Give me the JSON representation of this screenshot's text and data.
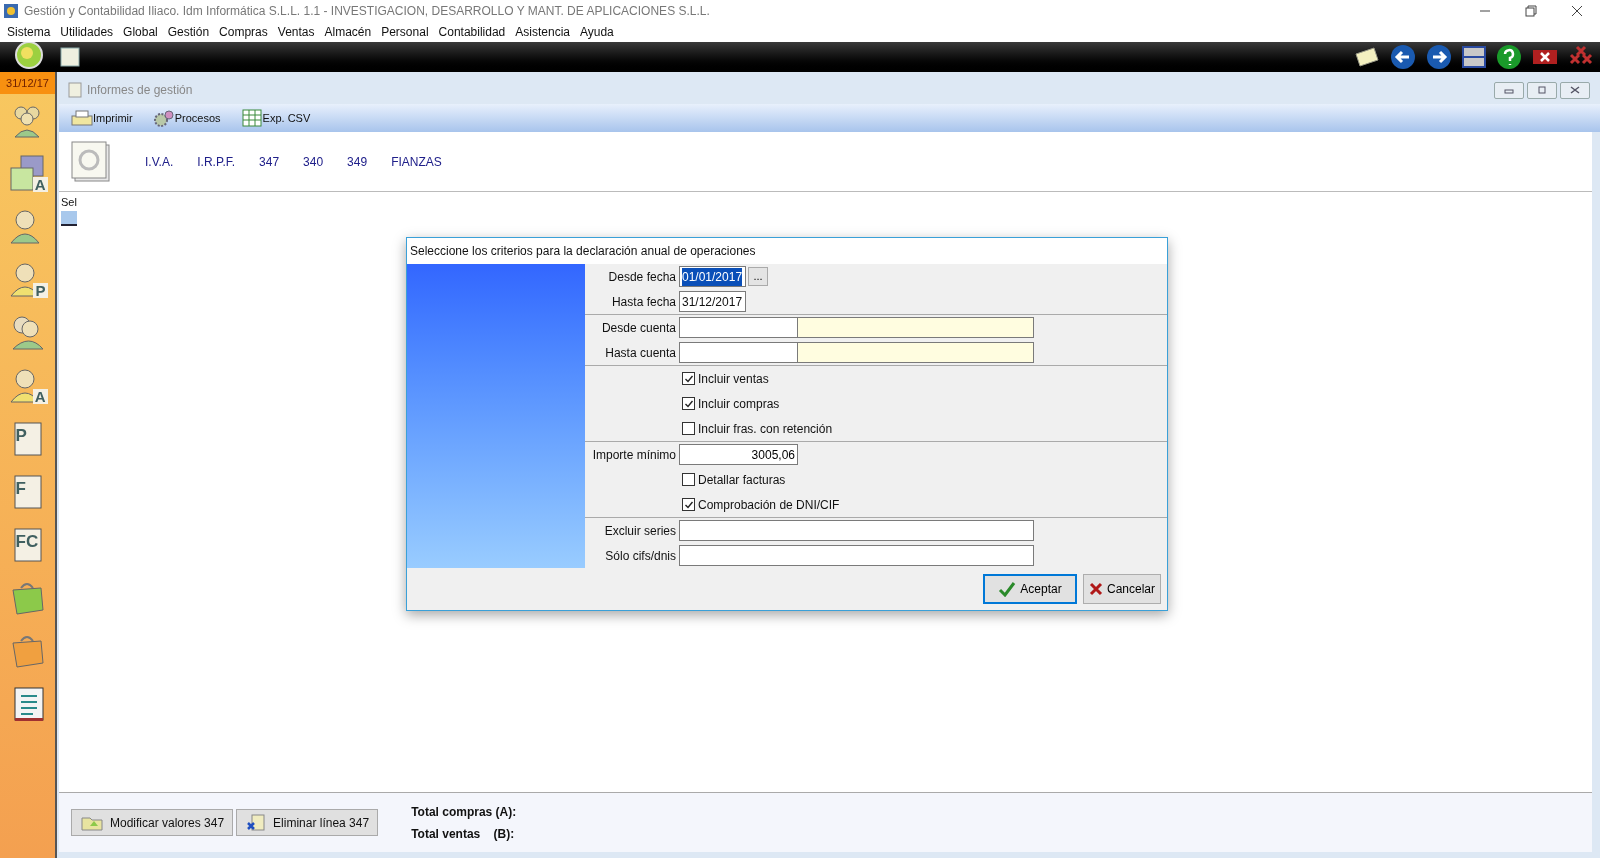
{
  "app_title": "Gestión y Contabilidad Iliaco. Idm Informática S.L.L. 1.1 - INVESTIGACION, DESARROLLO Y MANT. DE APLICACIONES S.L.L.",
  "menu": [
    "Sistema",
    "Utilidades",
    "Global",
    "Gestión",
    "Compras",
    "Ventas",
    "Almacén",
    "Personal",
    "Contabilidad",
    "Asistencia",
    "Ayuda"
  ],
  "date": "31/12/17",
  "sidebar": [
    {
      "kind": "group"
    },
    {
      "kind": "boxes",
      "letter": "A"
    },
    {
      "kind": "person"
    },
    {
      "kind": "person",
      "letter": "P"
    },
    {
      "kind": "pair"
    },
    {
      "kind": "person",
      "letter": "A"
    },
    {
      "kind": "doc",
      "letter": "P"
    },
    {
      "kind": "doc",
      "letter": "F"
    },
    {
      "kind": "doc",
      "letter": "FC"
    },
    {
      "kind": "bag",
      "color": "#8cc94a"
    },
    {
      "kind": "bag",
      "color": "#f0a040"
    },
    {
      "kind": "book"
    }
  ],
  "window": {
    "title": "Informes de gestión"
  },
  "toolbar": [
    {
      "kind": "print",
      "label": "Imprimir"
    },
    {
      "kind": "gears",
      "label": "Procesos"
    },
    {
      "kind": "sheet",
      "label": "Exp. CSV"
    }
  ],
  "tabs": [
    {
      "label": "I.V.A."
    },
    {
      "label": "I.R.P.F."
    },
    {
      "label": "347"
    },
    {
      "label": "340"
    },
    {
      "label": "349"
    },
    {
      "label": "FIANZAS"
    }
  ],
  "grid": {
    "column_1": "Sel"
  },
  "dialog": {
    "title": "Seleccione los criterios para la declaración anual de operaciones",
    "sections": [
      [
        {
          "kind": "date",
          "label": "Desde fecha",
          "value": "01/01/2017",
          "selected": true,
          "button": "..."
        },
        {
          "kind": "date",
          "label": "Hasta fecha",
          "value": "31/12/2017",
          "selected": false
        }
      ],
      [
        {
          "kind": "account",
          "label": "Desde cuenta"
        },
        {
          "kind": "account",
          "label": "Hasta cuenta"
        }
      ],
      [
        {
          "kind": "check",
          "label": "Incluir ventas",
          "checked": true
        },
        {
          "kind": "check",
          "label": "Incluir compras",
          "checked": true
        },
        {
          "kind": "check",
          "label": "Incluir fras. con retención",
          "checked": false
        }
      ],
      [
        {
          "kind": "amount",
          "label": "Importe mínimo",
          "value": "3005,06"
        },
        {
          "kind": "check",
          "label": "Detallar facturas",
          "checked": false
        },
        {
          "kind": "check",
          "label": "Comprobación de DNI/CIF",
          "checked": true
        }
      ],
      [
        {
          "kind": "text",
          "label": "Excluir series"
        },
        {
          "kind": "text",
          "label": "Sólo cifs/dnis"
        }
      ]
    ],
    "buttons": [
      {
        "kind": "ok",
        "label": "Aceptar"
      },
      {
        "kind": "cancel",
        "label": "Cancelar"
      }
    ]
  },
  "bottom_buttons": [
    {
      "kind": "folder",
      "label": "Modificar valores 347"
    },
    {
      "kind": "delete",
      "label": "Eliminar línea 347"
    }
  ],
  "totals": [
    {
      "label": "Total compras (A):"
    },
    {
      "label": "Total ventas    (B):"
    }
  ]
}
